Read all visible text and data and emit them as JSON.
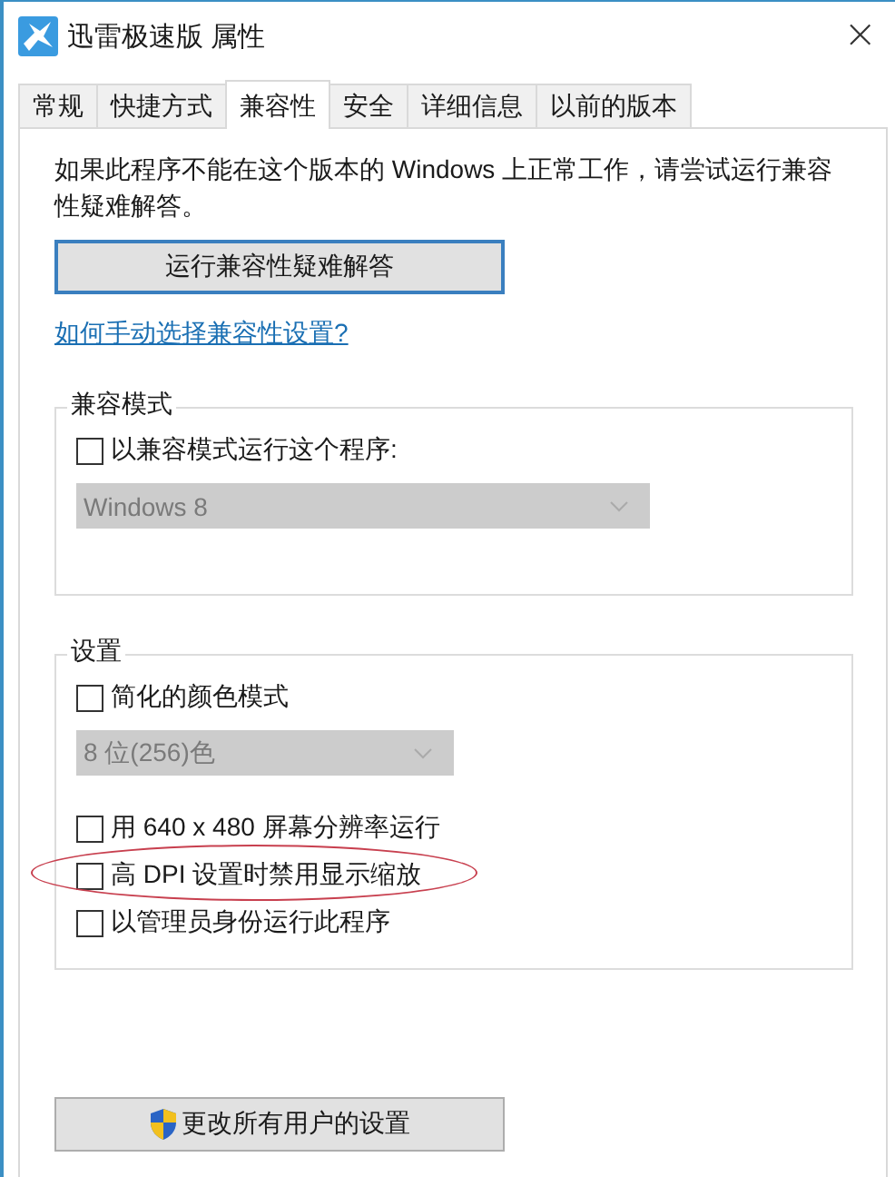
{
  "window": {
    "title": "迅雷极速版 属性",
    "close": "×"
  },
  "tabs": [
    {
      "label": "常规",
      "selected": false
    },
    {
      "label": "快捷方式",
      "selected": false
    },
    {
      "label": "兼容性",
      "selected": true
    },
    {
      "label": "安全",
      "selected": false
    },
    {
      "label": "详细信息",
      "selected": false
    },
    {
      "label": "以前的版本",
      "selected": false
    }
  ],
  "description": "如果此程序不能在这个版本的 Windows 上正常工作，请尝试运行兼容性疑难解答。",
  "troubleshoot_button": "运行兼容性疑难解答",
  "help_link": "如何手动选择兼容性设置?",
  "groups": [
    {
      "title": "兼容模式",
      "items": [
        {
          "kind": "checkbox",
          "label": "以兼容模式运行这个程序:",
          "checked": false,
          "highlighted": false
        },
        {
          "kind": "dropdown",
          "value": "Windows 8",
          "disabled": true
        }
      ]
    },
    {
      "title": "设置",
      "items": [
        {
          "kind": "checkbox",
          "label": "简化的颜色模式",
          "checked": false,
          "highlighted": false
        },
        {
          "kind": "dropdown",
          "value": "8 位(256)色",
          "disabled": true
        },
        {
          "kind": "checkbox",
          "label": "用 640 x 480 屏幕分辨率运行",
          "checked": false,
          "highlighted": false
        },
        {
          "kind": "checkbox",
          "label": "高 DPI 设置时禁用显示缩放",
          "checked": false,
          "highlighted": true
        },
        {
          "kind": "checkbox",
          "label": "以管理员身份运行此程序",
          "checked": false,
          "highlighted": false
        }
      ]
    }
  ],
  "all_users_button": "更改所有用户的设置"
}
